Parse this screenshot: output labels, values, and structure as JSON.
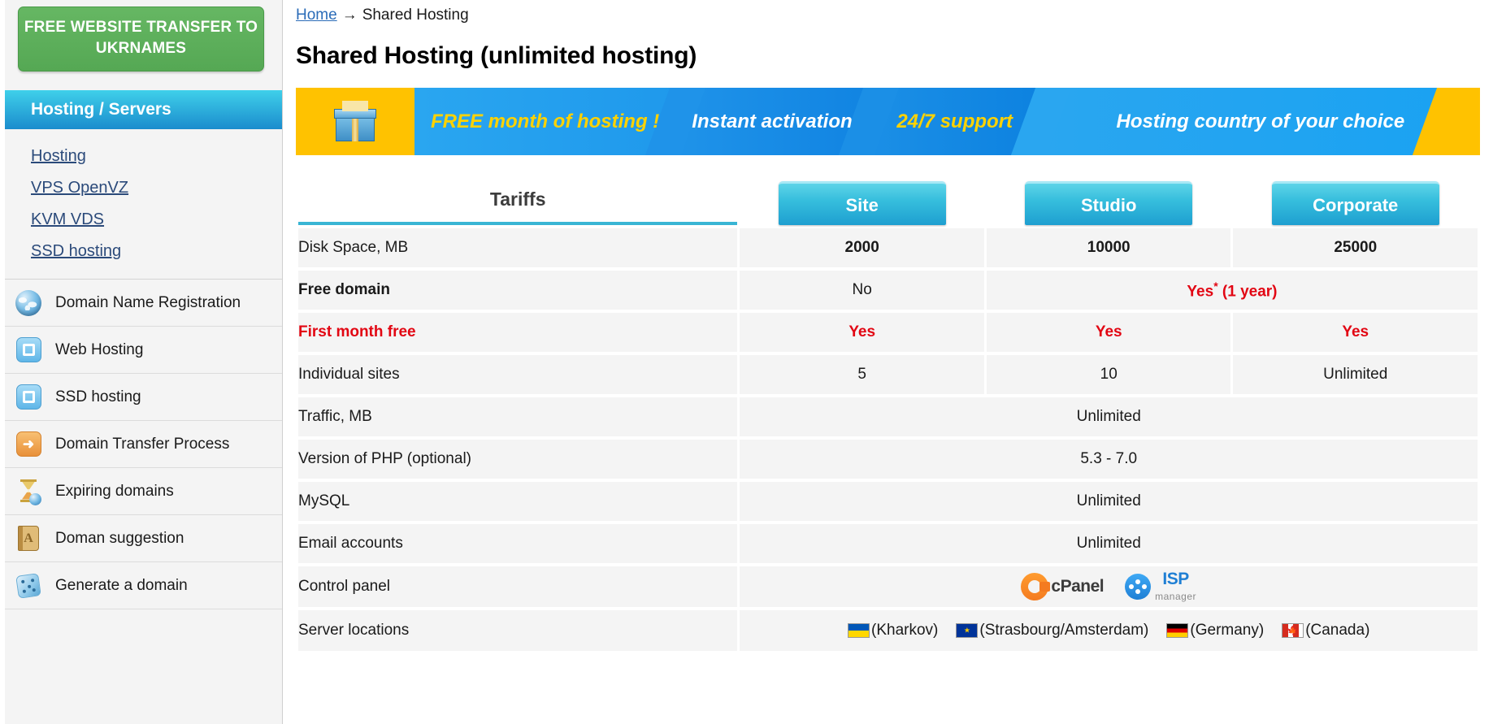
{
  "sidebar": {
    "promo_button": "FREE WEBSITE TRANSFER TO UKRNAMES",
    "section_title": "Hosting / Servers",
    "links": [
      {
        "label": "Hosting"
      },
      {
        "label": "VPS OpenVZ"
      },
      {
        "label": "KVM VDS"
      },
      {
        "label": "SSD hosting"
      }
    ],
    "items": [
      {
        "label": "Domain Name Registration",
        "icon": "globe-icon"
      },
      {
        "label": "Web Hosting",
        "icon": "rounded-square-icon"
      },
      {
        "label": "SSD hosting",
        "icon": "rounded-square-icon"
      },
      {
        "label": "Domain Transfer Process",
        "icon": "arrow-right-icon"
      },
      {
        "label": "Expiring domains",
        "icon": "hourglass-icon"
      },
      {
        "label": "Doman suggestion",
        "icon": "book-icon"
      },
      {
        "label": "Generate a domain",
        "icon": "dice-icon"
      }
    ]
  },
  "breadcrumb": {
    "home": "Home",
    "arrow": "→",
    "current": "Shared Hosting"
  },
  "page_title": "Shared Hosting (unlimited hosting)",
  "promo_strip": {
    "gift_icon": "gift-box-icon",
    "segments": [
      {
        "text": "FREE month of hosting !",
        "color": "#ffd200"
      },
      {
        "text": "Instant activation",
        "color": "#ffffff"
      },
      {
        "text": "24/7 support",
        "color": "#ffd200"
      },
      {
        "text": "Hosting country of your choice",
        "color": "#ffffff"
      }
    ]
  },
  "tariff_table": {
    "header_label": "Tariffs",
    "plans": [
      {
        "name": "Site"
      },
      {
        "name": "Studio"
      },
      {
        "name": "Corporate"
      }
    ],
    "rows": [
      {
        "label": "Disk Space, MB",
        "label_style": "normal",
        "cells": [
          {
            "text": "2000",
            "style": "bold"
          },
          {
            "text": "10000",
            "style": "bold"
          },
          {
            "text": "25000",
            "style": "bold"
          }
        ]
      },
      {
        "label": "Free domain",
        "label_style": "bold",
        "cells": [
          {
            "text": "No",
            "style": "normal"
          },
          {
            "text": "Yes* (1 year)",
            "style": "red",
            "span": 2
          }
        ]
      },
      {
        "label": "First month free",
        "label_style": "red",
        "cells": [
          {
            "text": "Yes",
            "style": "red"
          },
          {
            "text": "Yes",
            "style": "red"
          },
          {
            "text": "Yes",
            "style": "red"
          }
        ]
      },
      {
        "label": "Individual sites",
        "label_style": "normal",
        "cells": [
          {
            "text": "5",
            "style": "normal"
          },
          {
            "text": "10",
            "style": "normal"
          },
          {
            "text": "Unlimited",
            "style": "normal"
          }
        ]
      },
      {
        "label": "Traffic, MB",
        "label_style": "normal",
        "cells": [
          {
            "text": "Unlimited",
            "style": "normal",
            "span": 3
          }
        ]
      },
      {
        "label": "Version of PHP (optional)",
        "label_style": "normal",
        "cells": [
          {
            "text": "5.3 - 7.0",
            "style": "normal",
            "span": 3
          }
        ]
      },
      {
        "label": "MySQL",
        "label_style": "normal",
        "cells": [
          {
            "text": "Unlimited",
            "style": "normal",
            "span": 3
          }
        ]
      },
      {
        "label": "Email accounts",
        "label_style": "normal",
        "cells": [
          {
            "text": "Unlimited",
            "style": "normal",
            "span": 3
          }
        ]
      },
      {
        "label": "Control panel",
        "label_style": "normal",
        "cells": [
          {
            "text": "",
            "style": "logos",
            "span": 3
          }
        ]
      },
      {
        "label": "Server locations",
        "label_style": "normal",
        "cells": [
          {
            "text": "",
            "style": "locations",
            "span": 3
          }
        ]
      }
    ],
    "control_panels": [
      {
        "name": "cPanel",
        "icon": "cpanel-logo-icon"
      },
      {
        "name": "ISP",
        "sub": "manager",
        "icon": "ispmanager-logo-icon"
      }
    ],
    "server_locations": [
      {
        "flag": "ukraine-flag-icon",
        "label": "(Kharkov)"
      },
      {
        "flag": "eu-flag-icon",
        "label": "(Strasbourg/Amsterdam)"
      },
      {
        "flag": "germany-flag-icon",
        "label": "(Germany)"
      },
      {
        "flag": "canada-flag-icon",
        "label": "(Canada)"
      }
    ]
  }
}
